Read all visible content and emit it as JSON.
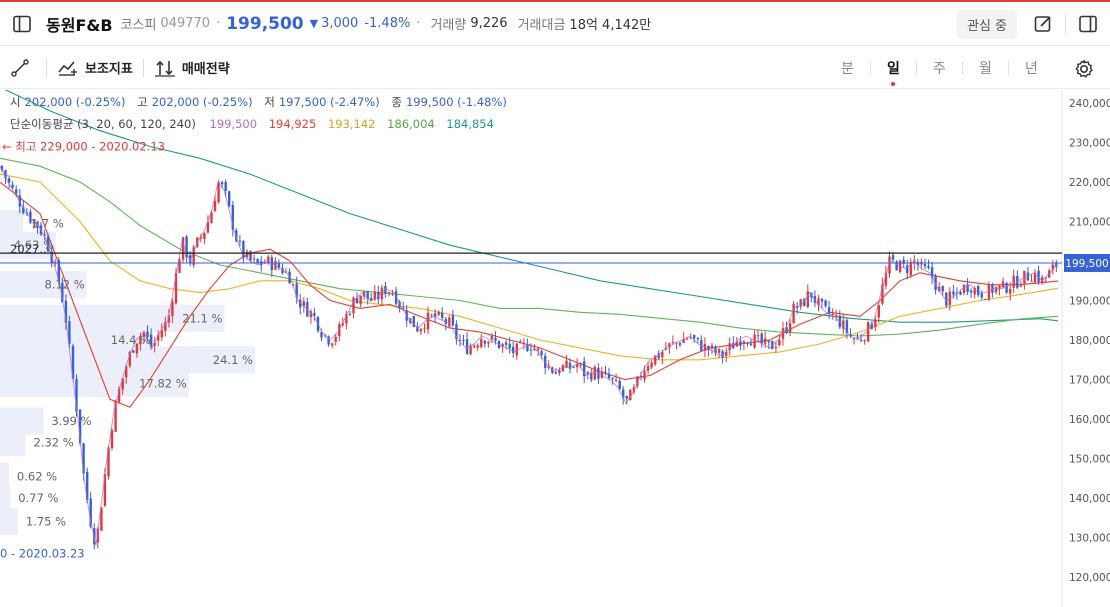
{
  "header": {
    "stock_name": "동원F&B",
    "market": "코스피",
    "code": "049770",
    "price": "199,500",
    "change_arrow": "▼",
    "change": "3,000",
    "change_pct": "-1.48%",
    "volume_label": "거래량",
    "volume": "9,226",
    "turnover_label": "거래대금",
    "turnover": "18억 4,142만",
    "watch_label": "관심 중"
  },
  "toolbar": {
    "indicators_label": "보조지표",
    "strategy_label": "매매전략",
    "periods": [
      {
        "label": "분",
        "active": false
      },
      {
        "label": "일",
        "active": true
      },
      {
        "label": "주",
        "active": false
      },
      {
        "label": "월",
        "active": false
      },
      {
        "label": "년",
        "active": false
      }
    ]
  },
  "info": {
    "open_label": "시",
    "open": "202,000 (-0.25%)",
    "high_label": "고",
    "high": "202,000 (-0.25%)",
    "low_label": "저",
    "low": "197,500 (-2.47%)",
    "close_label": "종",
    "close": "199,500 (-1.48%)",
    "ma_label": "단순이동평균 (3, 20, 60, 120, 240)",
    "ma_values": [
      "199,500",
      "194,925",
      "193,142",
      "186,004",
      "184,854"
    ]
  },
  "colors": {
    "up": "#e03a3a",
    "down": "#3562d8",
    "ma3": "#b06ad8",
    "ma20": "#e8402c",
    "ma60": "#f0b22a",
    "ma120": "#63b35c",
    "ma240": "#1f9a8a"
  },
  "chart_data": {
    "type": "candlestick",
    "y_axis": {
      "min": 115000,
      "max": 245000,
      "ticks": [
        120000,
        130000,
        140000,
        150000,
        160000,
        170000,
        180000,
        190000,
        200000,
        210000,
        220000,
        230000,
        240000
      ],
      "tick_labels": [
        "120,000",
        "130,000",
        "140,000",
        "150,000",
        "160,000",
        "170,000",
        "180,000",
        "190,000",
        "200,000",
        "210,000",
        "220,000",
        "230,000",
        "240,000"
      ]
    },
    "current_price": 199500,
    "current_price_label": "199,500",
    "resistance_price": 202000,
    "high_marker": {
      "text": "← 최고 229,000 - 2020.02.13",
      "price": 229000
    },
    "low_marker": {
      "text": "0 - 2020.03.23",
      "price": 126000
    },
    "extra_label": {
      "text": "2027..",
      "price": 203000
    },
    "volume_profile": [
      {
        "pct": "1.75 %",
        "price": 134000,
        "ratio": 0.07
      },
      {
        "pct": "0.77 %",
        "price": 140000,
        "ratio": 0.04
      },
      {
        "pct": "0.62 %",
        "price": 145500,
        "ratio": 0.035
      },
      {
        "pct": "2.32 %",
        "price": 154000,
        "ratio": 0.1
      },
      {
        "pct": "3.99 %",
        "price": 159500,
        "ratio": 0.17
      },
      {
        "pct": "17.82 %",
        "price": 169000,
        "ratio": 0.74
      },
      {
        "pct": "24.1 %",
        "price": 175000,
        "ratio": 1.0
      },
      {
        "pct": "14.4 %",
        "price": 180000,
        "ratio": 0.6
      },
      {
        "pct": "21.1 %",
        "price": 185500,
        "ratio": 0.88
      },
      {
        "pct": "8.12 %",
        "price": 194000,
        "ratio": 0.34
      },
      {
        "pct": "4.63 %",
        "price": 204000,
        "ratio": 0.22
      },
      {
        "pct": "1.7 %",
        "price": 209500,
        "ratio": 0.09
      }
    ],
    "price_path": [
      [
        0,
        224000
      ],
      [
        8,
        220000
      ],
      [
        15,
        217000
      ],
      [
        22,
        214000
      ],
      [
        30,
        211000
      ],
      [
        38,
        209000
      ],
      [
        45,
        206000
      ],
      [
        52,
        201000
      ],
      [
        60,
        194000
      ],
      [
        66,
        185000
      ],
      [
        72,
        172000
      ],
      [
        78,
        160000
      ],
      [
        84,
        145000
      ],
      [
        90,
        135000
      ],
      [
        96,
        128000
      ],
      [
        102,
        140000
      ],
      [
        108,
        152000
      ],
      [
        114,
        162000
      ],
      [
        120,
        168000
      ],
      [
        128,
        175000
      ],
      [
        136,
        180000
      ],
      [
        144,
        182000
      ],
      [
        152,
        178000
      ],
      [
        160,
        182000
      ],
      [
        168,
        185000
      ],
      [
        175,
        195000
      ],
      [
        182,
        205000
      ],
      [
        190,
        200000
      ],
      [
        198,
        205000
      ],
      [
        205,
        208000
      ],
      [
        212,
        213000
      ],
      [
        218,
        220000
      ],
      [
        224,
        218000
      ],
      [
        230,
        212000
      ],
      [
        236,
        206000
      ],
      [
        242,
        202000
      ],
      [
        250,
        200000
      ],
      [
        258,
        199000
      ],
      [
        266,
        200000
      ],
      [
        274,
        199000
      ],
      [
        282,
        198000
      ],
      [
        290,
        196000
      ],
      [
        298,
        190000
      ],
      [
        306,
        188000
      ],
      [
        314,
        186000
      ],
      [
        322,
        182000
      ],
      [
        330,
        180000
      ],
      [
        338,
        182000
      ],
      [
        346,
        186000
      ],
      [
        354,
        190000
      ],
      [
        362,
        192000
      ],
      [
        370,
        190000
      ],
      [
        378,
        191000
      ],
      [
        386,
        193000
      ],
      [
        394,
        192000
      ],
      [
        402,
        188000
      ],
      [
        410,
        185000
      ],
      [
        418,
        183000
      ],
      [
        426,
        185000
      ],
      [
        434,
        186000
      ],
      [
        442,
        185000
      ],
      [
        450,
        184000
      ],
      [
        458,
        180000
      ],
      [
        466,
        178000
      ],
      [
        474,
        179000
      ],
      [
        482,
        181000
      ],
      [
        490,
        180000
      ],
      [
        498,
        179000
      ],
      [
        506,
        178000
      ],
      [
        514,
        177000
      ],
      [
        522,
        178000
      ],
      [
        530,
        179000
      ],
      [
        538,
        177000
      ],
      [
        546,
        174000
      ],
      [
        554,
        172000
      ],
      [
        562,
        173000
      ],
      [
        570,
        173000
      ],
      [
        578,
        174000
      ],
      [
        586,
        171000
      ],
      [
        594,
        172000
      ],
      [
        602,
        171000
      ],
      [
        610,
        170000
      ],
      [
        618,
        168000
      ],
      [
        626,
        164000
      ],
      [
        634,
        167000
      ],
      [
        642,
        172000
      ],
      [
        650,
        175000
      ],
      [
        658,
        176000
      ],
      [
        666,
        178000
      ],
      [
        674,
        179000
      ],
      [
        682,
        180000
      ],
      [
        690,
        181000
      ],
      [
        698,
        179000
      ],
      [
        706,
        178000
      ],
      [
        714,
        177000
      ],
      [
        722,
        176000
      ],
      [
        730,
        178000
      ],
      [
        738,
        180000
      ],
      [
        746,
        181000
      ],
      [
        754,
        180000
      ],
      [
        762,
        179000
      ],
      [
        770,
        178000
      ],
      [
        778,
        180000
      ],
      [
        786,
        183000
      ],
      [
        794,
        188000
      ],
      [
        802,
        189000
      ],
      [
        810,
        192000
      ],
      [
        818,
        189000
      ],
      [
        826,
        187000
      ],
      [
        834,
        186000
      ],
      [
        842,
        184000
      ],
      [
        850,
        181000
      ],
      [
        858,
        180000
      ],
      [
        866,
        182000
      ],
      [
        874,
        185000
      ],
      [
        882,
        193000
      ],
      [
        890,
        200000
      ],
      [
        898,
        199000
      ],
      [
        906,
        198000
      ],
      [
        914,
        200000
      ],
      [
        922,
        198000
      ],
      [
        930,
        197000
      ],
      [
        938,
        193000
      ],
      [
        946,
        190000
      ],
      [
        954,
        191000
      ],
      [
        962,
        193000
      ],
      [
        970,
        194000
      ],
      [
        978,
        192000
      ],
      [
        986,
        192000
      ],
      [
        994,
        193000
      ],
      [
        1002,
        193000
      ],
      [
        1010,
        194000
      ],
      [
        1018,
        195000
      ],
      [
        1026,
        196000
      ],
      [
        1034,
        197000
      ],
      [
        1042,
        195000
      ],
      [
        1050,
        197000
      ],
      [
        1058,
        199500
      ]
    ],
    "ma": {
      "ma20": [
        [
          0,
          220000
        ],
        [
          40,
          212000
        ],
        [
          80,
          185000
        ],
        [
          110,
          165000
        ],
        [
          130,
          163000
        ],
        [
          150,
          170000
        ],
        [
          170,
          178000
        ],
        [
          190,
          186000
        ],
        [
          210,
          193000
        ],
        [
          230,
          199000
        ],
        [
          250,
          202000
        ],
        [
          270,
          203000
        ],
        [
          290,
          200000
        ],
        [
          310,
          194000
        ],
        [
          330,
          190000
        ],
        [
          360,
          188000
        ],
        [
          390,
          189000
        ],
        [
          420,
          186000
        ],
        [
          450,
          183000
        ],
        [
          480,
          182000
        ],
        [
          510,
          180000
        ],
        [
          540,
          178000
        ],
        [
          570,
          175000
        ],
        [
          600,
          172000
        ],
        [
          625,
          170000
        ],
        [
          650,
          171000
        ],
        [
          680,
          175000
        ],
        [
          710,
          178000
        ],
        [
          740,
          179000
        ],
        [
          770,
          180000
        ],
        [
          800,
          184000
        ],
        [
          830,
          187000
        ],
        [
          860,
          186000
        ],
        [
          880,
          190000
        ],
        [
          900,
          195000
        ],
        [
          920,
          197000
        ],
        [
          940,
          196000
        ],
        [
          960,
          195000
        ],
        [
          990,
          194000
        ],
        [
          1020,
          194000
        ],
        [
          1058,
          194900
        ]
      ],
      "ma60": [
        [
          0,
          222000
        ],
        [
          40,
          220000
        ],
        [
          80,
          210000
        ],
        [
          110,
          200000
        ],
        [
          140,
          195000
        ],
        [
          170,
          193000
        ],
        [
          200,
          192000
        ],
        [
          230,
          193000
        ],
        [
          260,
          195000
        ],
        [
          290,
          195000
        ],
        [
          320,
          193000
        ],
        [
          350,
          190000
        ],
        [
          380,
          189000
        ],
        [
          420,
          188000
        ],
        [
          460,
          186000
        ],
        [
          500,
          183000
        ],
        [
          540,
          180000
        ],
        [
          580,
          178000
        ],
        [
          620,
          176000
        ],
        [
          660,
          175000
        ],
        [
          700,
          175000
        ],
        [
          740,
          176000
        ],
        [
          780,
          177000
        ],
        [
          820,
          179000
        ],
        [
          860,
          182000
        ],
        [
          900,
          186000
        ],
        [
          940,
          188000
        ],
        [
          980,
          190000
        ],
        [
          1020,
          191500
        ],
        [
          1058,
          193100
        ]
      ],
      "ma120": [
        [
          0,
          226000
        ],
        [
          40,
          224000
        ],
        [
          80,
          220000
        ],
        [
          110,
          215000
        ],
        [
          140,
          209000
        ],
        [
          180,
          203000
        ],
        [
          220,
          199000
        ],
        [
          260,
          197000
        ],
        [
          300,
          195000
        ],
        [
          340,
          193000
        ],
        [
          380,
          192000
        ],
        [
          420,
          191000
        ],
        [
          460,
          190000
        ],
        [
          500,
          188000
        ],
        [
          540,
          188000
        ],
        [
          580,
          187000
        ],
        [
          620,
          186500
        ],
        [
          660,
          185500
        ],
        [
          700,
          184500
        ],
        [
          740,
          183000
        ],
        [
          780,
          182000
        ],
        [
          820,
          181500
        ],
        [
          860,
          181000
        ],
        [
          900,
          181500
        ],
        [
          940,
          182500
        ],
        [
          980,
          184000
        ],
        [
          1020,
          185300
        ],
        [
          1058,
          186000
        ]
      ],
      "ma240": [
        [
          0,
          244000
        ],
        [
          50,
          238000
        ],
        [
          100,
          233000
        ],
        [
          150,
          229000
        ],
        [
          200,
          226000
        ],
        [
          250,
          222000
        ],
        [
          300,
          217000
        ],
        [
          350,
          212000
        ],
        [
          400,
          208000
        ],
        [
          450,
          204000
        ],
        [
          500,
          201000
        ],
        [
          550,
          198000
        ],
        [
          600,
          195000
        ],
        [
          650,
          193000
        ],
        [
          700,
          191000
        ],
        [
          750,
          189000
        ],
        [
          800,
          187000
        ],
        [
          850,
          185500
        ],
        [
          900,
          184500
        ],
        [
          950,
          184500
        ],
        [
          1000,
          185000
        ],
        [
          1040,
          185400
        ],
        [
          1058,
          184850
        ]
      ]
    }
  }
}
